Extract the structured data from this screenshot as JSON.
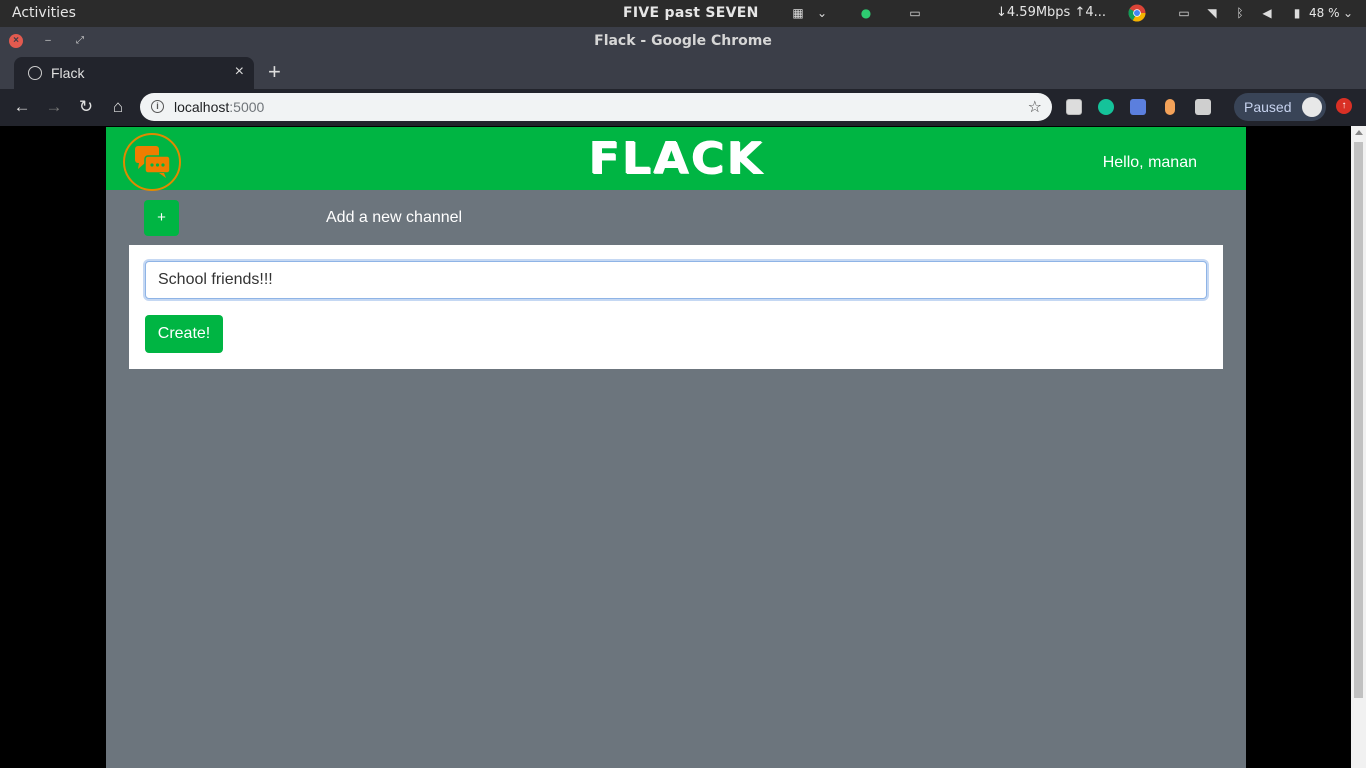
{
  "system_bar": {
    "activities": "Activities",
    "clock": "FIVE past SEVEN",
    "network_speed": "↓4.59Mbps ↑4...",
    "battery": "48 %"
  },
  "window": {
    "title": "Flack - Google Chrome"
  },
  "tabs": [
    {
      "label": "Flack",
      "active": true
    }
  ],
  "toolbar": {
    "url_host": "localhost",
    "url_port": ":5000",
    "profile_label": "Paused"
  },
  "app": {
    "brand": "FLACK",
    "greeting": "Hello, manan",
    "add_button_label": "+",
    "add_channel_label": "Add a new channel",
    "channel_input_value": "School friends!!!",
    "create_button_label": "Create!"
  },
  "colors": {
    "accent_green": "#00b543",
    "page_gray": "#6c757d",
    "logo_orange": "#e08a00"
  }
}
